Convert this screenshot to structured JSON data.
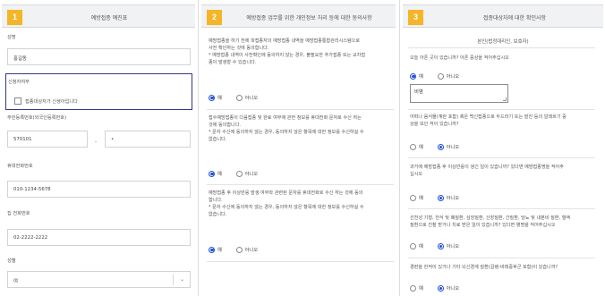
{
  "panel1": {
    "number": "1",
    "title": "예방접종 예진표",
    "name": {
      "label": "성명",
      "value": "홍길동"
    },
    "agent": {
      "label": "신청자여부",
      "checkbox_label": "접종대상자가 신생아입니다"
    },
    "rrn": {
      "label": "주민등록번호(외국인등록번호)",
      "front": "570101",
      "dash": "-",
      "back": "•"
    },
    "mobile": {
      "label": "휴대전화번호",
      "value": "010-1234-5678"
    },
    "home_phone": {
      "label": "집 전화번호",
      "value": "02-2222-2222"
    },
    "gender": {
      "label": "성별",
      "value": "여"
    }
  },
  "panel2": {
    "number": "2",
    "title": "예방접종 업무를 위한 개인정보 처리 등에 대한 동의사항",
    "q1": {
      "line1": "예방접종을 하기 전에 피접종자의 예방접종 내역을 예방접종통합관리시스템으로",
      "line2": "사전 확인하는 것에 동의합니다.",
      "line3": "* 예방접종 내역이 사전확인에 동의하지 않는 경우, 불필요한 추가접종 또는 교차접",
      "line4": "종이 발생할 수 있습니다.",
      "yes": "예",
      "no": "아니오"
    },
    "q2": {
      "line1": "접수예방접종이 다음접종 및 완료 여부에 관한 정보를 휴대전화 문자로 수신 하는",
      "line2": "것에 동의합니다.",
      "line3": "* 문자 수신에 동의하지 않는 경우, 동의하지 않은 항목에 대한 정보를 수신하실 수",
      "line4": "없습니다.",
      "yes": "예",
      "no": "아니오"
    },
    "q3": {
      "line1": "예방접종 후 이상반응 발생 여부와 관련된 문자를 휴대전화로 수신 하는 것에 동의",
      "line2": "합니다.",
      "line3": "* 문자 수신에 동의하지 않는 경우, 동의하지 않은 항목에 대한 정보를 수신하실 수",
      "line4": "없습니다.",
      "yes": "예",
      "no": "아니오"
    }
  },
  "panel3": {
    "number": "3",
    "title": "접종대상자에 대한 확인사항",
    "subhead": "본인(법정대리인, 보호자)",
    "q1": {
      "line1": "오늘 아픈 곳이 있습니까? 아픈 증상을 적어주십시오",
      "yes": "예",
      "no": "아니오",
      "answer": "비염"
    },
    "q2": {
      "line1": "어떠나 음식물(계란 포함) 혹은 백신접종으로 두드러기 또는 발진 등의 알레르기 증",
      "line2": "상을 보인 적이 있습니까?",
      "yes": "예",
      "no": "아니오"
    },
    "q3": {
      "line1": "과거에 예방접종 후 이상반응이 생긴 일이 있습니까? 있다면 예방접종명을 적어주",
      "line2": "십시오",
      "yes": "예",
      "no": "아니오"
    },
    "q4": {
      "line1": "선천성 기형, 천식 및 폐질환, 심장질환, 신장질환, 간질환, 당뇨 및 내분비 질환, 혈액",
      "line2": "질환으로 진찰 받거나 치료 받은 일이 있습니까? 있다면 병명을 적어주십시오",
      "yes": "예",
      "no": "아니오"
    },
    "q5": {
      "line1": "경련을 한적이 있거나 기타 뇌신경계 질환(길랭-바레증후군 포함)이 있습니까?",
      "yes": "예",
      "no": "아니오"
    }
  },
  "colors": {
    "accent": "#f4b528",
    "radio_selected": "#1e4fd8",
    "agent_box_border": "#2d3a8c",
    "header_bg": "#f1f2f4"
  },
  "icons": {
    "dropdown": "chevron-down-icon"
  }
}
